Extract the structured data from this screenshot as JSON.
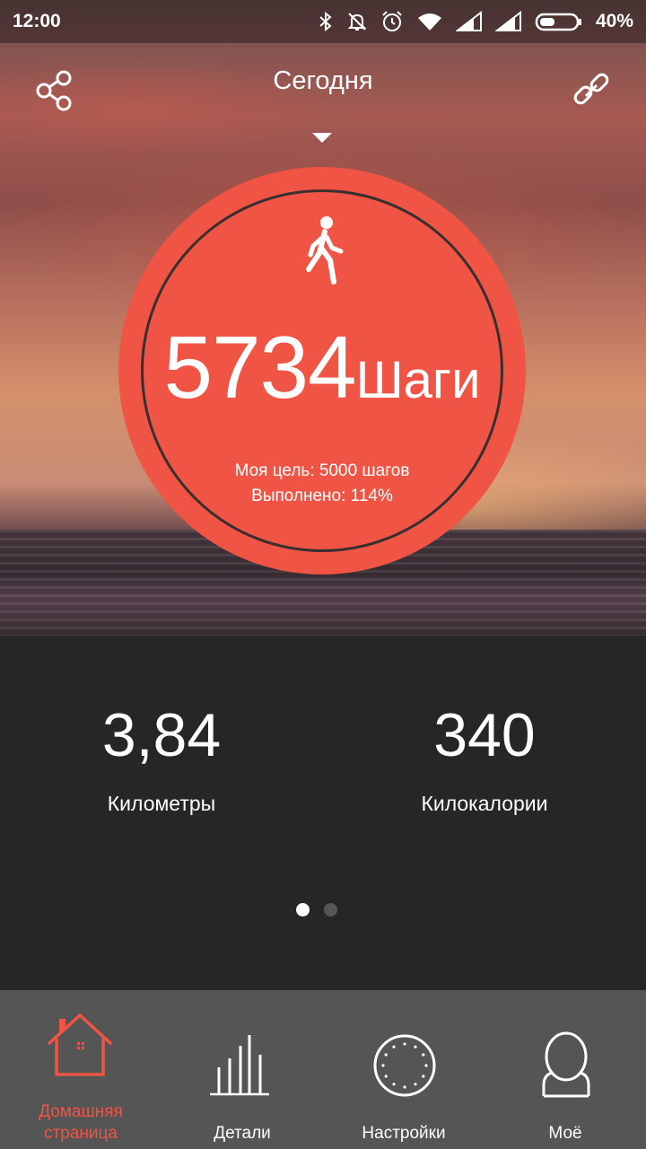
{
  "status_bar": {
    "time": "12:00",
    "battery_percent": "40%",
    "icons": [
      "bluetooth-icon",
      "bell-muted-icon",
      "alarm-icon",
      "wifi-icon",
      "signal-icon",
      "signal-icon",
      "battery-icon"
    ]
  },
  "header": {
    "title": "Сегодня",
    "share_icon": "share-icon",
    "link_icon": "link-icon",
    "dropdown_icon": "triangle-down-icon"
  },
  "steps": {
    "icon": "walking-person-icon",
    "value": "5734",
    "unit": "Шаги",
    "goal_text": "Моя цель: 5000 шагов",
    "completed_text": "Выполнено: 114%"
  },
  "stats": [
    {
      "value": "3,84",
      "label": "Километры"
    },
    {
      "value": "340",
      "label": "Килокалории"
    }
  ],
  "pager": {
    "count": 2,
    "active": 0
  },
  "bottom_nav": {
    "items": [
      {
        "label_line1": "Домашняя",
        "label_line2": "страница",
        "icon": "home-icon",
        "active": true
      },
      {
        "label": "Детали",
        "icon": "bar-chart-icon",
        "active": false
      },
      {
        "label": "Настройки",
        "icon": "dotted-circle-icon",
        "active": false
      },
      {
        "label": "Моё",
        "icon": "profile-icon",
        "active": false
      }
    ]
  },
  "colors": {
    "accent": "#ef5445",
    "bottom_nav_bg": "#555555",
    "stats_bg": "#262626"
  }
}
